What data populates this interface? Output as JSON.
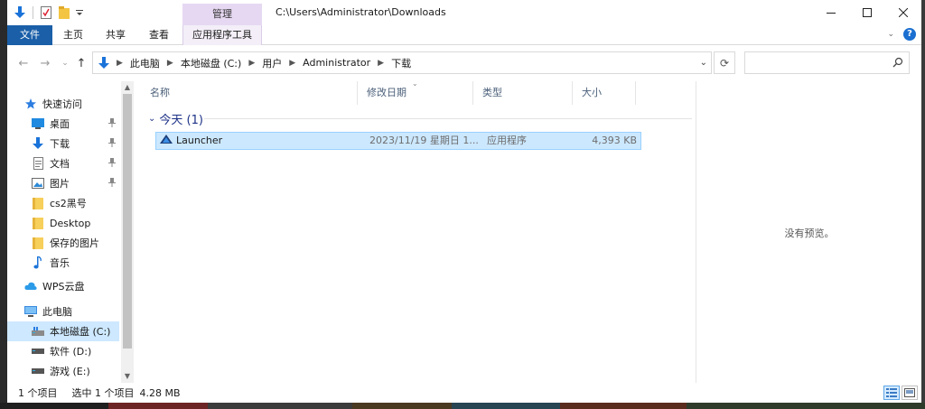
{
  "window": {
    "title": "C:\\Users\\Administrator\\Downloads",
    "manage_tab": "管理"
  },
  "ribbon": {
    "tabs": [
      "文件",
      "主页",
      "共享",
      "查看",
      "应用程序工具"
    ]
  },
  "address": {
    "segments": [
      "此电脑",
      "本地磁盘 (C:)",
      "用户",
      "Administrator",
      "下载"
    ],
    "search_placeholder": ""
  },
  "nav": {
    "items": [
      {
        "label": "快速访问",
        "icon": "star-icon"
      },
      {
        "label": "桌面",
        "icon": "desktop-icon",
        "pinned": true
      },
      {
        "label": "下载",
        "icon": "download-icon",
        "pinned": true
      },
      {
        "label": "文档",
        "icon": "document-icon",
        "pinned": true
      },
      {
        "label": "图片",
        "icon": "picture-icon",
        "pinned": true
      },
      {
        "label": "cs2黑号",
        "icon": "folder-icon"
      },
      {
        "label": "Desktop",
        "icon": "folder-icon"
      },
      {
        "label": "保存的图片",
        "icon": "folder-icon"
      },
      {
        "label": "音乐",
        "icon": "music-icon"
      },
      {
        "label": "WPS云盘",
        "icon": "cloud-icon"
      },
      {
        "label": "此电脑",
        "icon": "computer-icon"
      },
      {
        "label": "本地磁盘 (C:)",
        "icon": "drive-icon",
        "selected": true
      },
      {
        "label": "软件 (D:)",
        "icon": "drive-icon"
      },
      {
        "label": "游戏 (E:)",
        "icon": "drive-icon"
      }
    ]
  },
  "files": {
    "columns": [
      "名称",
      "修改日期",
      "类型",
      "大小"
    ],
    "group_label": "今天 (1)",
    "rows": [
      {
        "name": "Launcher",
        "date": "2023/11/19 星期日 1...",
        "type": "应用程序",
        "size": "4,393 KB"
      }
    ]
  },
  "preview": {
    "text": "没有预览。"
  },
  "status": {
    "count": "1 个项目",
    "selected": "选中 1 个项目",
    "size": "4.28 MB"
  },
  "colors": {
    "accent": "#1a5fa8",
    "selection": "#cce8ff",
    "manage_tab": "#e6d8f2"
  }
}
